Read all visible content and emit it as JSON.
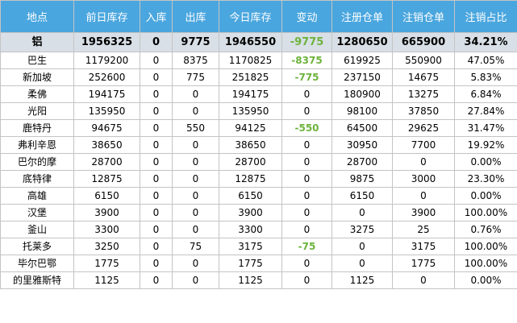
{
  "table": {
    "headers": [
      "地点",
      "前日库存",
      "入库",
      "出库",
      "今日库存",
      "变动",
      "注册仓单",
      "注销仓单",
      "注销占比"
    ],
    "rows": [
      {
        "cells": [
          "铝",
          "1956325",
          "0",
          "9775",
          "1946550",
          "-9775",
          "1280650",
          "665900",
          "34.21%"
        ],
        "total": true
      },
      {
        "cells": [
          "巴生",
          "1179200",
          "0",
          "8375",
          "1170825",
          "-8375",
          "619925",
          "550900",
          "47.05%"
        ]
      },
      {
        "cells": [
          "新加坡",
          "252600",
          "0",
          "775",
          "251825",
          "-775",
          "237150",
          "14675",
          "5.83%"
        ]
      },
      {
        "cells": [
          "柔佛",
          "194175",
          "0",
          "0",
          "194175",
          "0",
          "180900",
          "13275",
          "6.84%"
        ]
      },
      {
        "cells": [
          "光阳",
          "135950",
          "0",
          "0",
          "135950",
          "0",
          "98100",
          "37850",
          "27.84%"
        ]
      },
      {
        "cells": [
          "鹿特丹",
          "94675",
          "0",
          "550",
          "94125",
          "-550",
          "64500",
          "29625",
          "31.47%"
        ]
      },
      {
        "cells": [
          "弗利辛恩",
          "38650",
          "0",
          "0",
          "38650",
          "0",
          "30950",
          "7700",
          "19.92%"
        ]
      },
      {
        "cells": [
          "巴尔的摩",
          "28700",
          "0",
          "0",
          "28700",
          "0",
          "28700",
          "0",
          "0.00%"
        ]
      },
      {
        "cells": [
          "底特律",
          "12875",
          "0",
          "0",
          "12875",
          "0",
          "9875",
          "3000",
          "23.30%"
        ]
      },
      {
        "cells": [
          "高雄",
          "6150",
          "0",
          "0",
          "6150",
          "0",
          "6150",
          "0",
          "0.00%"
        ]
      },
      {
        "cells": [
          "汉堡",
          "3900",
          "0",
          "0",
          "3900",
          "0",
          "0",
          "3900",
          "100.00%"
        ]
      },
      {
        "cells": [
          "釜山",
          "3300",
          "0",
          "0",
          "3300",
          "0",
          "3275",
          "25",
          "0.76%"
        ]
      },
      {
        "cells": [
          "托莱多",
          "3250",
          "0",
          "75",
          "3175",
          "-75",
          "0",
          "3175",
          "100.00%"
        ]
      },
      {
        "cells": [
          "毕尔巴鄂",
          "1775",
          "0",
          "0",
          "1775",
          "0",
          "0",
          "1775",
          "100.00%"
        ]
      },
      {
        "cells": [
          "的里雅斯特",
          "1125",
          "0",
          "0",
          "1125",
          "0",
          "1125",
          "0",
          "0.00%"
        ]
      }
    ]
  },
  "colors": {
    "header_bg": "#4aa6de",
    "header_text": "#ffffff",
    "total_row_bg": "#d8dfe6",
    "negative_change": "#6cb33c",
    "grid": "#c4c4c4"
  }
}
